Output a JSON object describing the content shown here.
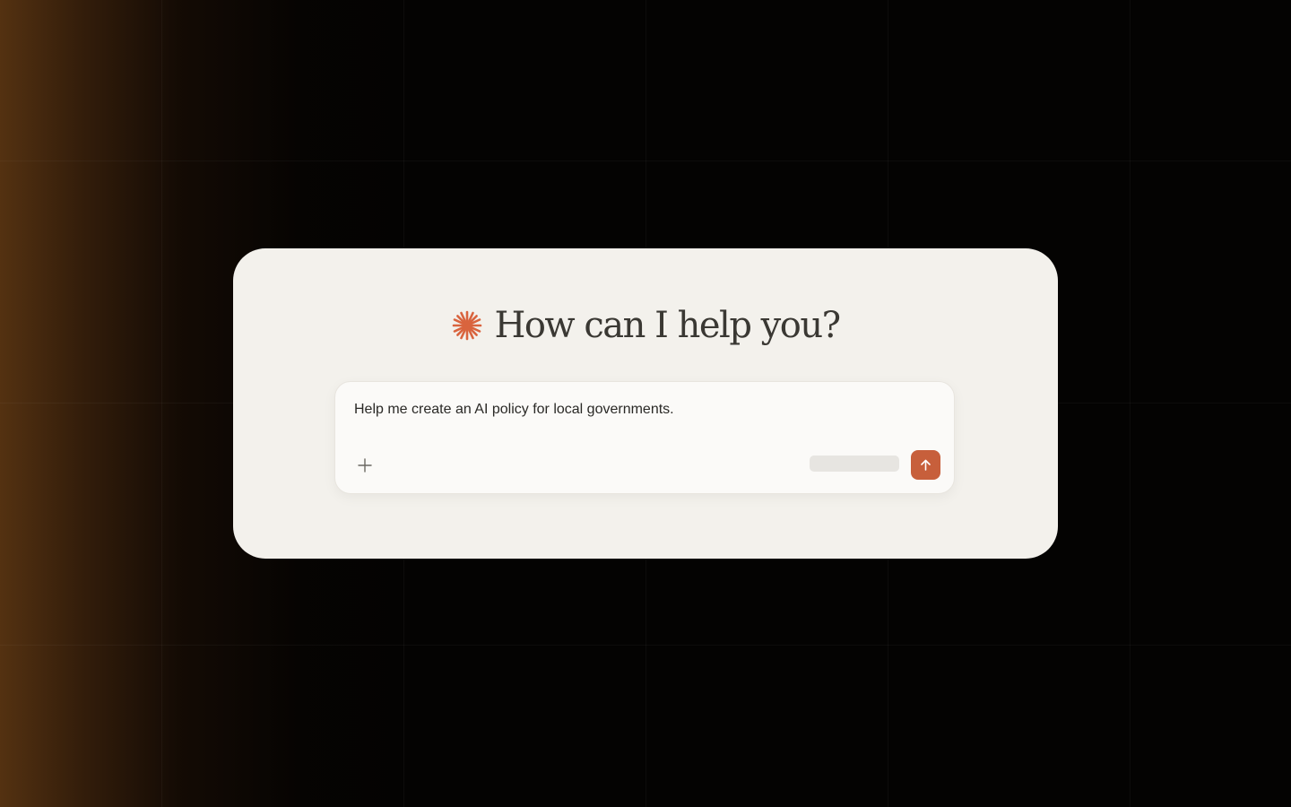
{
  "heading": {
    "title": "How can I help you?",
    "logo_icon": "sparkle-asterisk-icon",
    "logo_color": "#d9643e"
  },
  "composer": {
    "prompt_text": "Help me create an AI policy for local governments.",
    "attach_icon": "plus-icon",
    "send_icon": "arrow-up-icon",
    "send_color": "#c75f3b"
  },
  "colors": {
    "card_background": "#f3f1ec",
    "page_background": "#040302",
    "glow": "#583412"
  }
}
